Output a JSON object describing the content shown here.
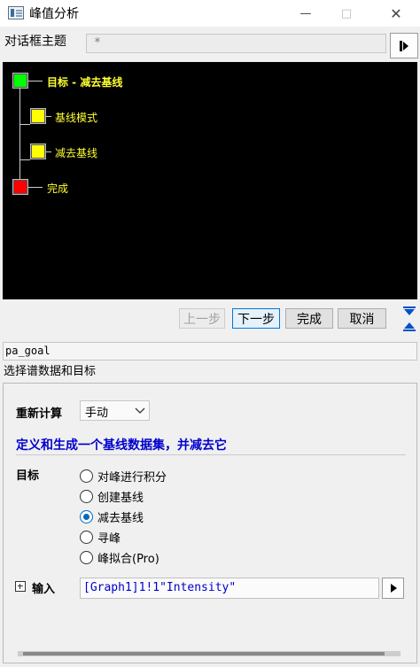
{
  "window": {
    "title": "峰值分析",
    "minimize": "—",
    "maximize": "□",
    "close": "✕"
  },
  "theme": {
    "label": "对话框主题",
    "value": "*"
  },
  "flow": {
    "nodes": [
      {
        "label": "目标 - 减去基线",
        "color": "#00ff00"
      },
      {
        "label": "基线模式",
        "color": "#ffff00"
      },
      {
        "label": "减去基线",
        "color": "#ffff00"
      },
      {
        "label": "完成",
        "color": "#ff0000"
      }
    ]
  },
  "buttons": {
    "prev": "上一步",
    "next": "下一步",
    "finish": "完成",
    "cancel": "取消"
  },
  "status": {
    "code": "pa_goal",
    "description": "选择谱数据和目标"
  },
  "settings": {
    "recalc_label": "重新计算",
    "recalc_value": "手动",
    "headline": "定义和生成一个基线数据集，并减去它",
    "goal_label": "目标",
    "options": [
      {
        "label": "对峰进行积分",
        "selected": false
      },
      {
        "label": "创建基线",
        "selected": false
      },
      {
        "label": "减去基线",
        "selected": true
      },
      {
        "label": "寻峰",
        "selected": false
      },
      {
        "label": "峰拟合(Pro)",
        "selected": false
      }
    ],
    "input_label": "输入",
    "input_value": "[Graph1]1!1\"Intensity\""
  },
  "colors": {
    "accent": "#0067c0",
    "headline": "#0000cc",
    "flow_text": "#ffff33"
  }
}
